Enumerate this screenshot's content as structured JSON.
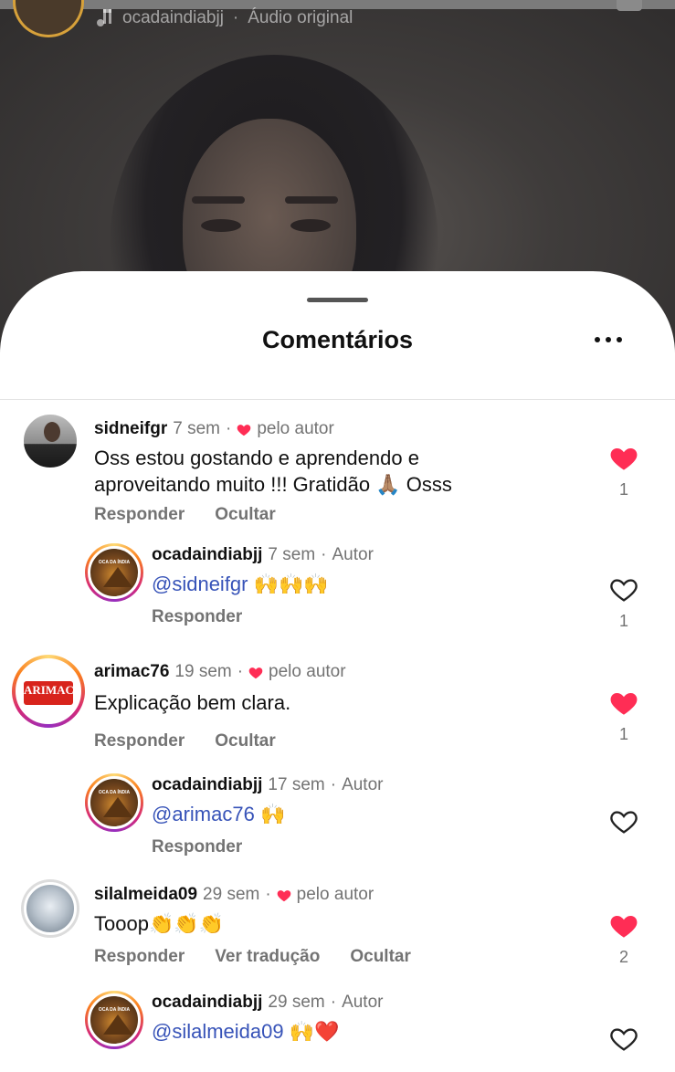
{
  "audio": {
    "username": "ocadaindiabjj",
    "label": "Áudio original",
    "separator": "·"
  },
  "sheet": {
    "title": "Comentários"
  },
  "comments": [
    {
      "user": "sidneifgr",
      "time": "7 sem",
      "liked_by_author": "pelo autor",
      "text_line1": "Oss estou gostando e aprendendo e",
      "text_line2": "aproveitando muito !!! Gratidão",
      "text_emoji": "🙏🏽",
      "text_tail": "Osss",
      "reply": "Responder",
      "hide": "Ocultar",
      "likes": "1",
      "liked": true
    },
    {
      "user": "ocadaindiabjj",
      "time": "7 sem",
      "tag": "Autor",
      "mention": "@sidneifgr",
      "emoji": "🙌🙌🙌",
      "reply": "Responder",
      "likes": "1",
      "liked": false
    },
    {
      "user": "arimac76",
      "time": "19 sem",
      "liked_by_author": "pelo autor",
      "text": "Explicação bem clara.",
      "avatar_logo": "ARIMAC",
      "reply": "Responder",
      "hide": "Ocultar",
      "likes": "1",
      "liked": true
    },
    {
      "user": "ocadaindiabjj",
      "time": "17 sem",
      "tag": "Autor",
      "mention": "@arimac76",
      "emoji": "🙌",
      "reply": "Responder",
      "liked": false
    },
    {
      "user": "silalmeida09",
      "time": "29 sem",
      "liked_by_author": "pelo autor",
      "text": "Tooop",
      "emoji": "👏👏👏",
      "reply": "Responder",
      "translate": "Ver tradução",
      "hide": "Ocultar",
      "likes": "2",
      "liked": true
    },
    {
      "user": "ocadaindiabjj",
      "time": "29 sem",
      "tag": "Autor",
      "mention": "@silalmeida09",
      "emoji": "🙌❤️",
      "liked": false
    }
  ],
  "colors": {
    "like_red": "#ff2d55",
    "mention_blue": "#3753b8",
    "meta_gray": "#737373"
  },
  "icons": {
    "heart_filled": "heart-filled-icon",
    "heart_outline": "heart-outline-icon",
    "more": "more-dots-icon",
    "music": "music-note-icon"
  }
}
